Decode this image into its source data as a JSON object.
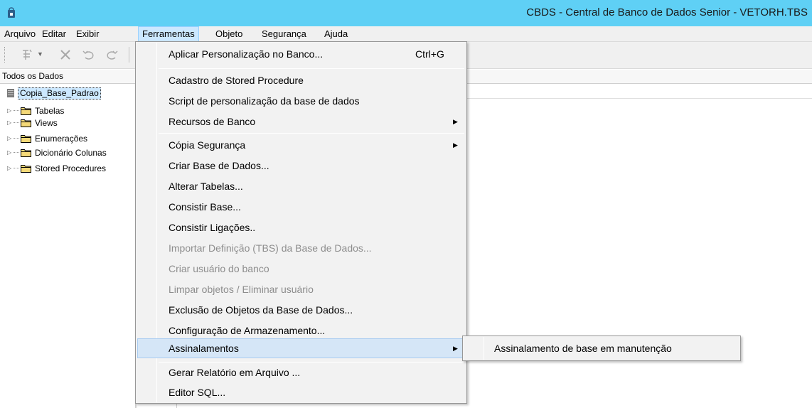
{
  "window": {
    "title": "CBDS - Central de Banco de Dados Senior - VETORH.TBS",
    "accent": "#5fd0f5"
  },
  "menubar": [
    {
      "label": "Arquivo"
    },
    {
      "label": "Editar"
    },
    {
      "label": "Exibir"
    },
    {
      "label": "Ferramentas",
      "open": true
    },
    {
      "label": "Objeto"
    },
    {
      "label": "Segurança"
    },
    {
      "label": "Ajuda"
    }
  ],
  "toolbar": {
    "icons": [
      "new-object-icon",
      "dropdown-arrow-icon",
      "delete-icon",
      "undo-icon",
      "redo-icon"
    ]
  },
  "tree": {
    "header": "Todos os Dados",
    "root": "Copia_Base_Padrao",
    "nodes": [
      {
        "label": "Tabelas"
      },
      {
        "label": "Views"
      },
      {
        "label": "Enumerações"
      },
      {
        "label": "Dicionário Colunas"
      },
      {
        "label": "Stored Procedures"
      }
    ]
  },
  "ferramentas_menu": [
    {
      "label": "Aplicar Personalização no Banco...",
      "shortcut": "Ctrl+G",
      "enabled": true
    },
    {
      "label": "Cadastro de Stored Procedure",
      "enabled": true
    },
    {
      "label": "Script de personalização da base de dados",
      "enabled": true
    },
    {
      "label": "Recursos de Banco",
      "enabled": true,
      "submenu": true
    },
    {
      "label": "Cópia Segurança",
      "enabled": true,
      "submenu": true
    },
    {
      "label": "Criar Base de Dados...",
      "enabled": true
    },
    {
      "label": "Alterar Tabelas...",
      "enabled": true
    },
    {
      "label": "Consistir Base...",
      "enabled": true
    },
    {
      "label": "Consistir Ligações..",
      "enabled": true
    },
    {
      "label": "Importar Definição (TBS) da Base de Dados...",
      "enabled": false
    },
    {
      "label": "Criar usuário do banco",
      "enabled": false
    },
    {
      "label": "Limpar objetos / Eliminar usuário",
      "enabled": false
    },
    {
      "label": "Exclusão de Objetos da Base de Dados...",
      "enabled": true
    },
    {
      "label": "Configuração de Armazenamento...",
      "enabled": true
    },
    {
      "label": "Assinalamentos",
      "enabled": true,
      "submenu": true,
      "highlighted": true
    },
    {
      "label": "Gerar Relatório em Arquivo ...",
      "enabled": true
    },
    {
      "label": "Editor SQL...",
      "enabled": true
    }
  ],
  "assinalamentos_submenu": [
    {
      "label": "Assinalamento de base em manutenção"
    }
  ]
}
